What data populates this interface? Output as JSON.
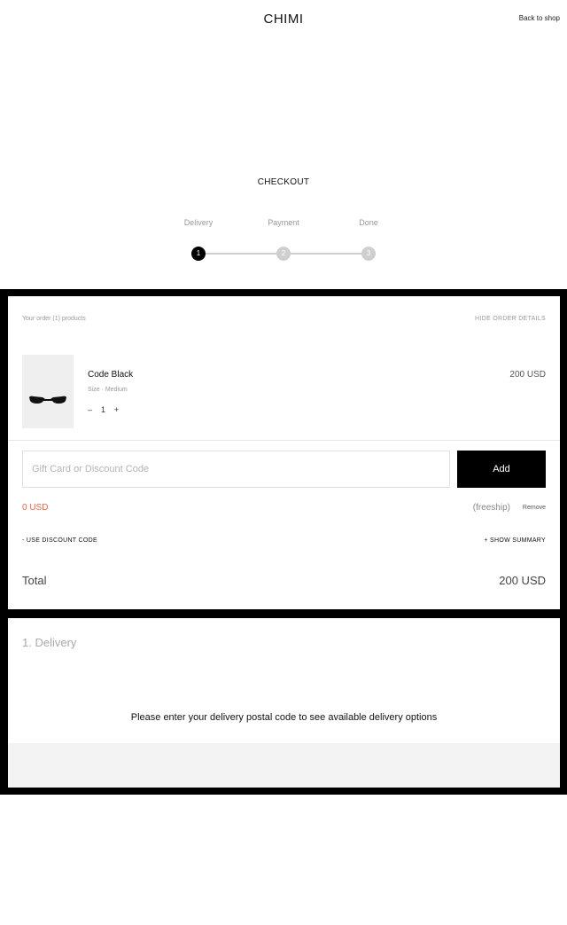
{
  "header": {
    "brand": "CHIMI",
    "back_link": "Back to shop"
  },
  "checkout": {
    "title": "CHECKOUT",
    "steps": [
      {
        "label": "Delivery",
        "number": "1",
        "state": "active"
      },
      {
        "label": "Payment",
        "number": "2",
        "state": "inactive"
      },
      {
        "label": "Done",
        "number": "3",
        "state": "inactive"
      }
    ]
  },
  "order": {
    "summary_text": "Your order (1) products",
    "hide_details": "HIDE ORDER DETAILS",
    "item": {
      "name": "Code Black",
      "size": "Size · Medium",
      "qty_minus": "–",
      "quantity": "1",
      "qty_plus": "+",
      "price": "200 USD",
      "image_icon": "sunglasses-icon"
    },
    "discount_input": {
      "placeholder": "Gift Card or Discount Code",
      "value": ""
    },
    "add_button": "Add",
    "discount_amount": "0 USD",
    "freeship": "(freeship)",
    "remove": "Remove",
    "use_discount": "- USE DISCOUNT CODE",
    "show_summary": "+ SHOW SUMMARY",
    "total_label": "Total",
    "total_value": "200 USD"
  },
  "delivery": {
    "title": "1. Delivery",
    "message": "Please enter your delivery postal code to see available delivery options"
  },
  "colors": {
    "accent": "#000000",
    "discount": "#e8664a",
    "step_inactive": "#cfcfcf",
    "panel_footer": "#f3f3f3"
  }
}
